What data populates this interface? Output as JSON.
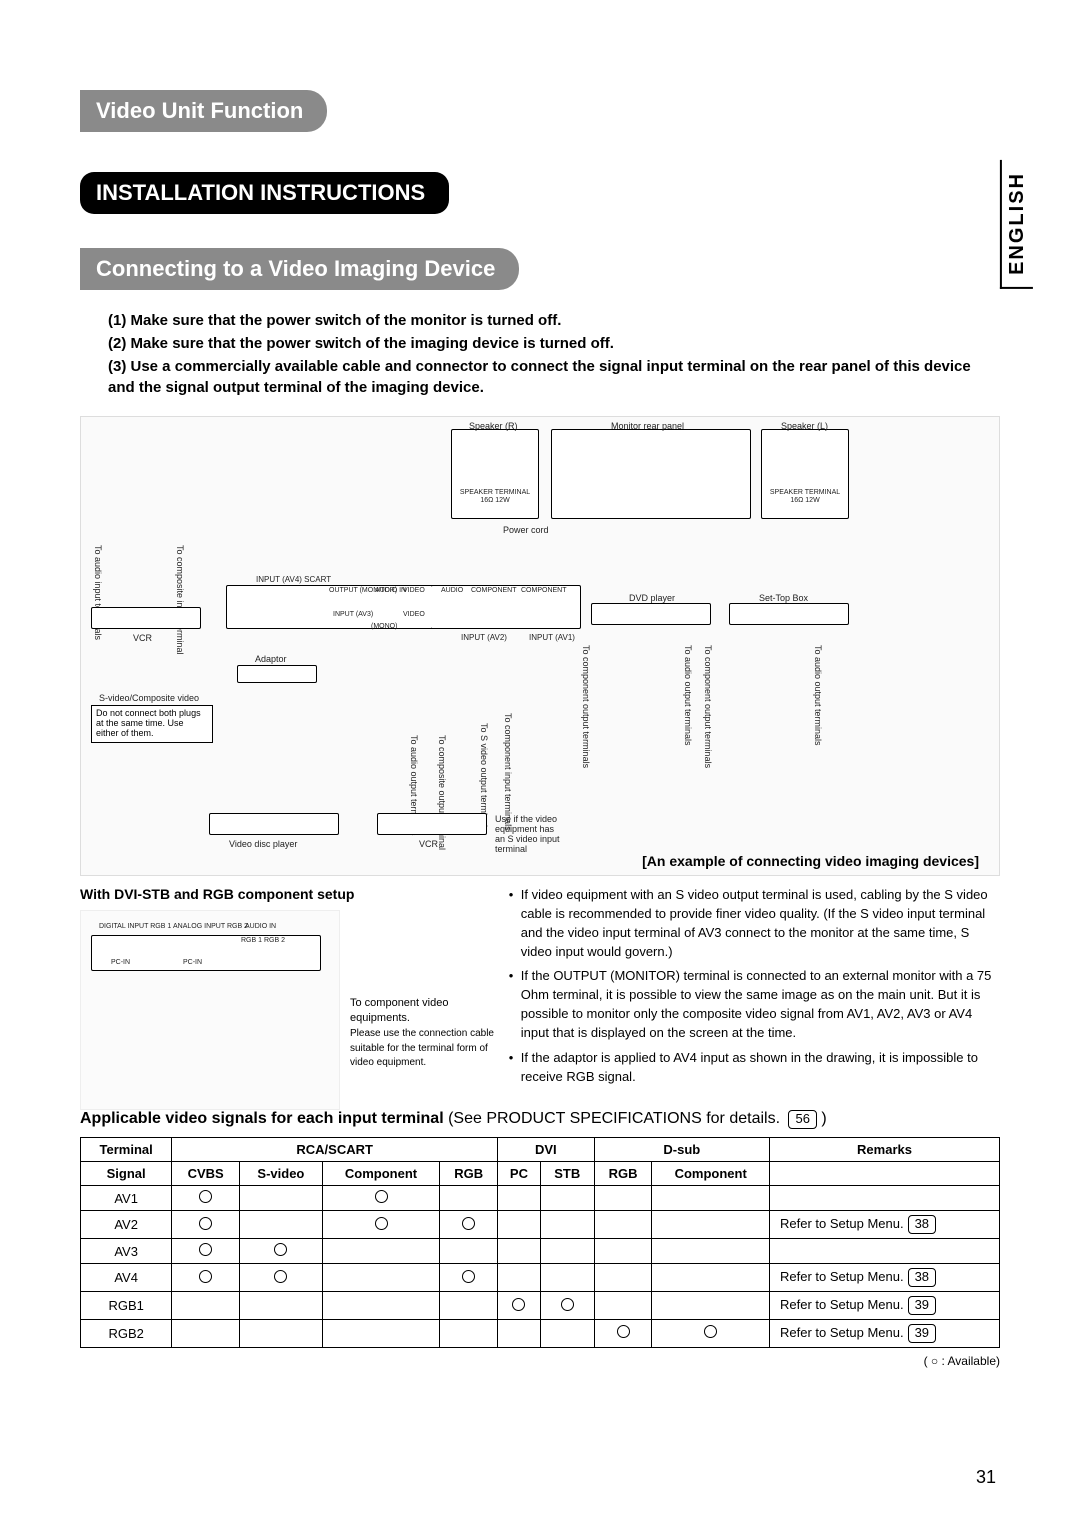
{
  "lang": "ENGLISH",
  "header_pill": "Video Unit Function",
  "install_pill": "INSTALLATION INSTRUCTIONS",
  "connect_pill": "Connecting to a Video Imaging Device",
  "steps": [
    "(1) Make sure that the power switch of the monitor is turned off.",
    "(2) Make sure that the power switch of the imaging device is turned off.",
    "(3) Use a commercially available cable and connector to connect the signal input terminal on the rear panel of this device and the signal output terminal of the imaging device."
  ],
  "diagram": {
    "speaker_r": "Speaker (R)",
    "speaker_l": "Speaker (L)",
    "monitor_rear": "Monitor rear panel",
    "power_cord": "Power cord",
    "speaker_terminal": "SPEAKER TERMINAL",
    "speaker_ohm": "16Ω 12W",
    "to_audio_input": "To audio input terminals",
    "to_composite_input": "To composite input terminal",
    "dvd_player": "DVD player",
    "settop": "Set-Top Box",
    "vcr": "VCR",
    "adaptor": "Adaptor",
    "svideo_composite": "S-video/Composite video",
    "do_not_connect": "Do not connect both plugs at the same time. Use either of them.",
    "to_audio_output": "To audio output terminals",
    "to_composite_output": "To composite output terminal",
    "to_svideo_output": "To S video output terminal",
    "to_component_input": "To component input terminals",
    "to_component_output": "To component output terminals",
    "to_audio_output2": "To audio output terminals",
    "use_if_svideo": "Use if the video equipment has an S video input terminal",
    "video_disc": "Video disc player",
    "input_av4_scart": "INPUT (AV4) SCART",
    "output_monitor": "OUTPUT (MONITOR)",
    "input_av3": "INPUT (AV3)",
    "input_av2": "INPUT (AV2)",
    "input_av1": "INPUT (AV1)",
    "audio_in": "AUDIO IN",
    "component": "COMPONENT",
    "video": "VIDEO",
    "svideo": "S-VIDEO",
    "mono": "(MONO)",
    "example_caption": "[An example of connecting video imaging devices]"
  },
  "setup_title": "With DVI-STB and RGB component setup",
  "setup_labels": {
    "digital_input": "DIGITAL INPUT RGB 1",
    "analog_input": "ANALOG INPUT RGB 2",
    "audio_in_pc": "AUDIO IN",
    "pc_in": "PC-IN",
    "rgb1_rgb2": "RGB 1 RGB 2"
  },
  "small_note": "To component video equipments.",
  "small_note2": "Please use the connection cable suitable for the terminal form of video equipment.",
  "bullets": [
    "If video equipment with an S video output terminal is used, cabling by the S video cable is recommended to provide finer video quality.  (If the S video input terminal and the video input terminal of AV3 connect to the monitor at the same time, S video input would govern.)",
    "If the OUTPUT (MONITOR) terminal is connected to an external monitor with a 75 Ohm terminal, it is possible to view the same image as on the main unit. But it is possible to monitor only the composite video signal from AV1, AV2, AV3 or AV4 input that is displayed on the screen at the time.",
    "If the adaptor is applied to AV4 input as shown in the drawing, it is impossible to  receive RGB signal."
  ],
  "table_title_bold": "Applicable video signals for each input terminal",
  "table_title_rest": " (See PRODUCT SPECIFICATIONS for details. ",
  "table_title_page": "56",
  "table_title_end": " )",
  "table": {
    "head1": {
      "terminal": "Terminal",
      "rca_scart": "RCA/SCART",
      "dvi": "DVI",
      "dsub": "D-sub",
      "remarks": "Remarks"
    },
    "head2": {
      "signal": "Signal",
      "cvbs": "CVBS",
      "svideo": "S-video",
      "component": "Component",
      "rgb": "RGB",
      "pc": "PC",
      "stb": "STB",
      "rgb2": "RGB",
      "component2": "Component"
    },
    "rows": [
      {
        "t": "AV1",
        "cvbs": true,
        "svideo": false,
        "component": true,
        "rgb": false,
        "pc": false,
        "stb": false,
        "rgb2": false,
        "component2": false,
        "remark": "",
        "page": ""
      },
      {
        "t": "AV2",
        "cvbs": true,
        "svideo": false,
        "component": true,
        "rgb": true,
        "pc": false,
        "stb": false,
        "rgb2": false,
        "component2": false,
        "remark": "Refer to Setup Menu.",
        "page": "38"
      },
      {
        "t": "AV3",
        "cvbs": true,
        "svideo": true,
        "component": false,
        "rgb": false,
        "pc": false,
        "stb": false,
        "rgb2": false,
        "component2": false,
        "remark": "",
        "page": ""
      },
      {
        "t": "AV4",
        "cvbs": true,
        "svideo": true,
        "component": false,
        "rgb": true,
        "pc": false,
        "stb": false,
        "rgb2": false,
        "component2": false,
        "remark": "Refer to Setup Menu.",
        "page": "38"
      },
      {
        "t": "RGB1",
        "cvbs": false,
        "svideo": false,
        "component": false,
        "rgb": false,
        "pc": true,
        "stb": true,
        "rgb2": false,
        "component2": false,
        "remark": "Refer to Setup Menu.",
        "page": "39"
      },
      {
        "t": "RGB2",
        "cvbs": false,
        "svideo": false,
        "component": false,
        "rgb": false,
        "pc": false,
        "stb": false,
        "rgb2": true,
        "component2": true,
        "remark": "Refer to Setup Menu.",
        "page": "39"
      }
    ]
  },
  "legend": "( ○ : Available)",
  "page_num": "31"
}
